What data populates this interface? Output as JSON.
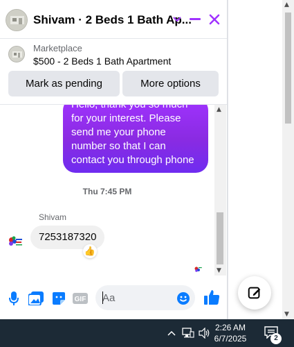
{
  "header": {
    "title": "Shivam · 2 Beds 1 Bath Ap...",
    "icons": [
      "chevron-down-icon",
      "minimize-icon",
      "close-icon"
    ],
    "accent": "#a033ff"
  },
  "marketplace": {
    "label": "Marketplace",
    "listing": "$500 - 2 Beds 1 Bath Apartment",
    "mark_pending_label": "Mark as pending",
    "more_options_label": "More options"
  },
  "thread": {
    "outgoing_lines": [
      "Hello, thank you so much",
      "for your interest. Please",
      "send me your phone",
      "number so that I can",
      "contact you through phone"
    ],
    "timestamp": "Thu 7:45 PM",
    "sender_name": "Shivam",
    "incoming_message": "7253187320",
    "reaction": "👍"
  },
  "composer": {
    "placeholder": "Aa",
    "icons": [
      "microphone-icon",
      "photo-icon",
      "sticker-icon",
      "gif-icon",
      "emoji-icon",
      "like-icon"
    ],
    "gif_label": "GIF"
  },
  "taskbar": {
    "time": "2:26 AM",
    "date": "6/7/2025",
    "notification_count": "2"
  },
  "colors": {
    "bubble_out": "#8a2be2",
    "bubble_in": "#f0f0f0",
    "icon_blue": "#0a7cff",
    "taskbar": "#1c2a36"
  }
}
